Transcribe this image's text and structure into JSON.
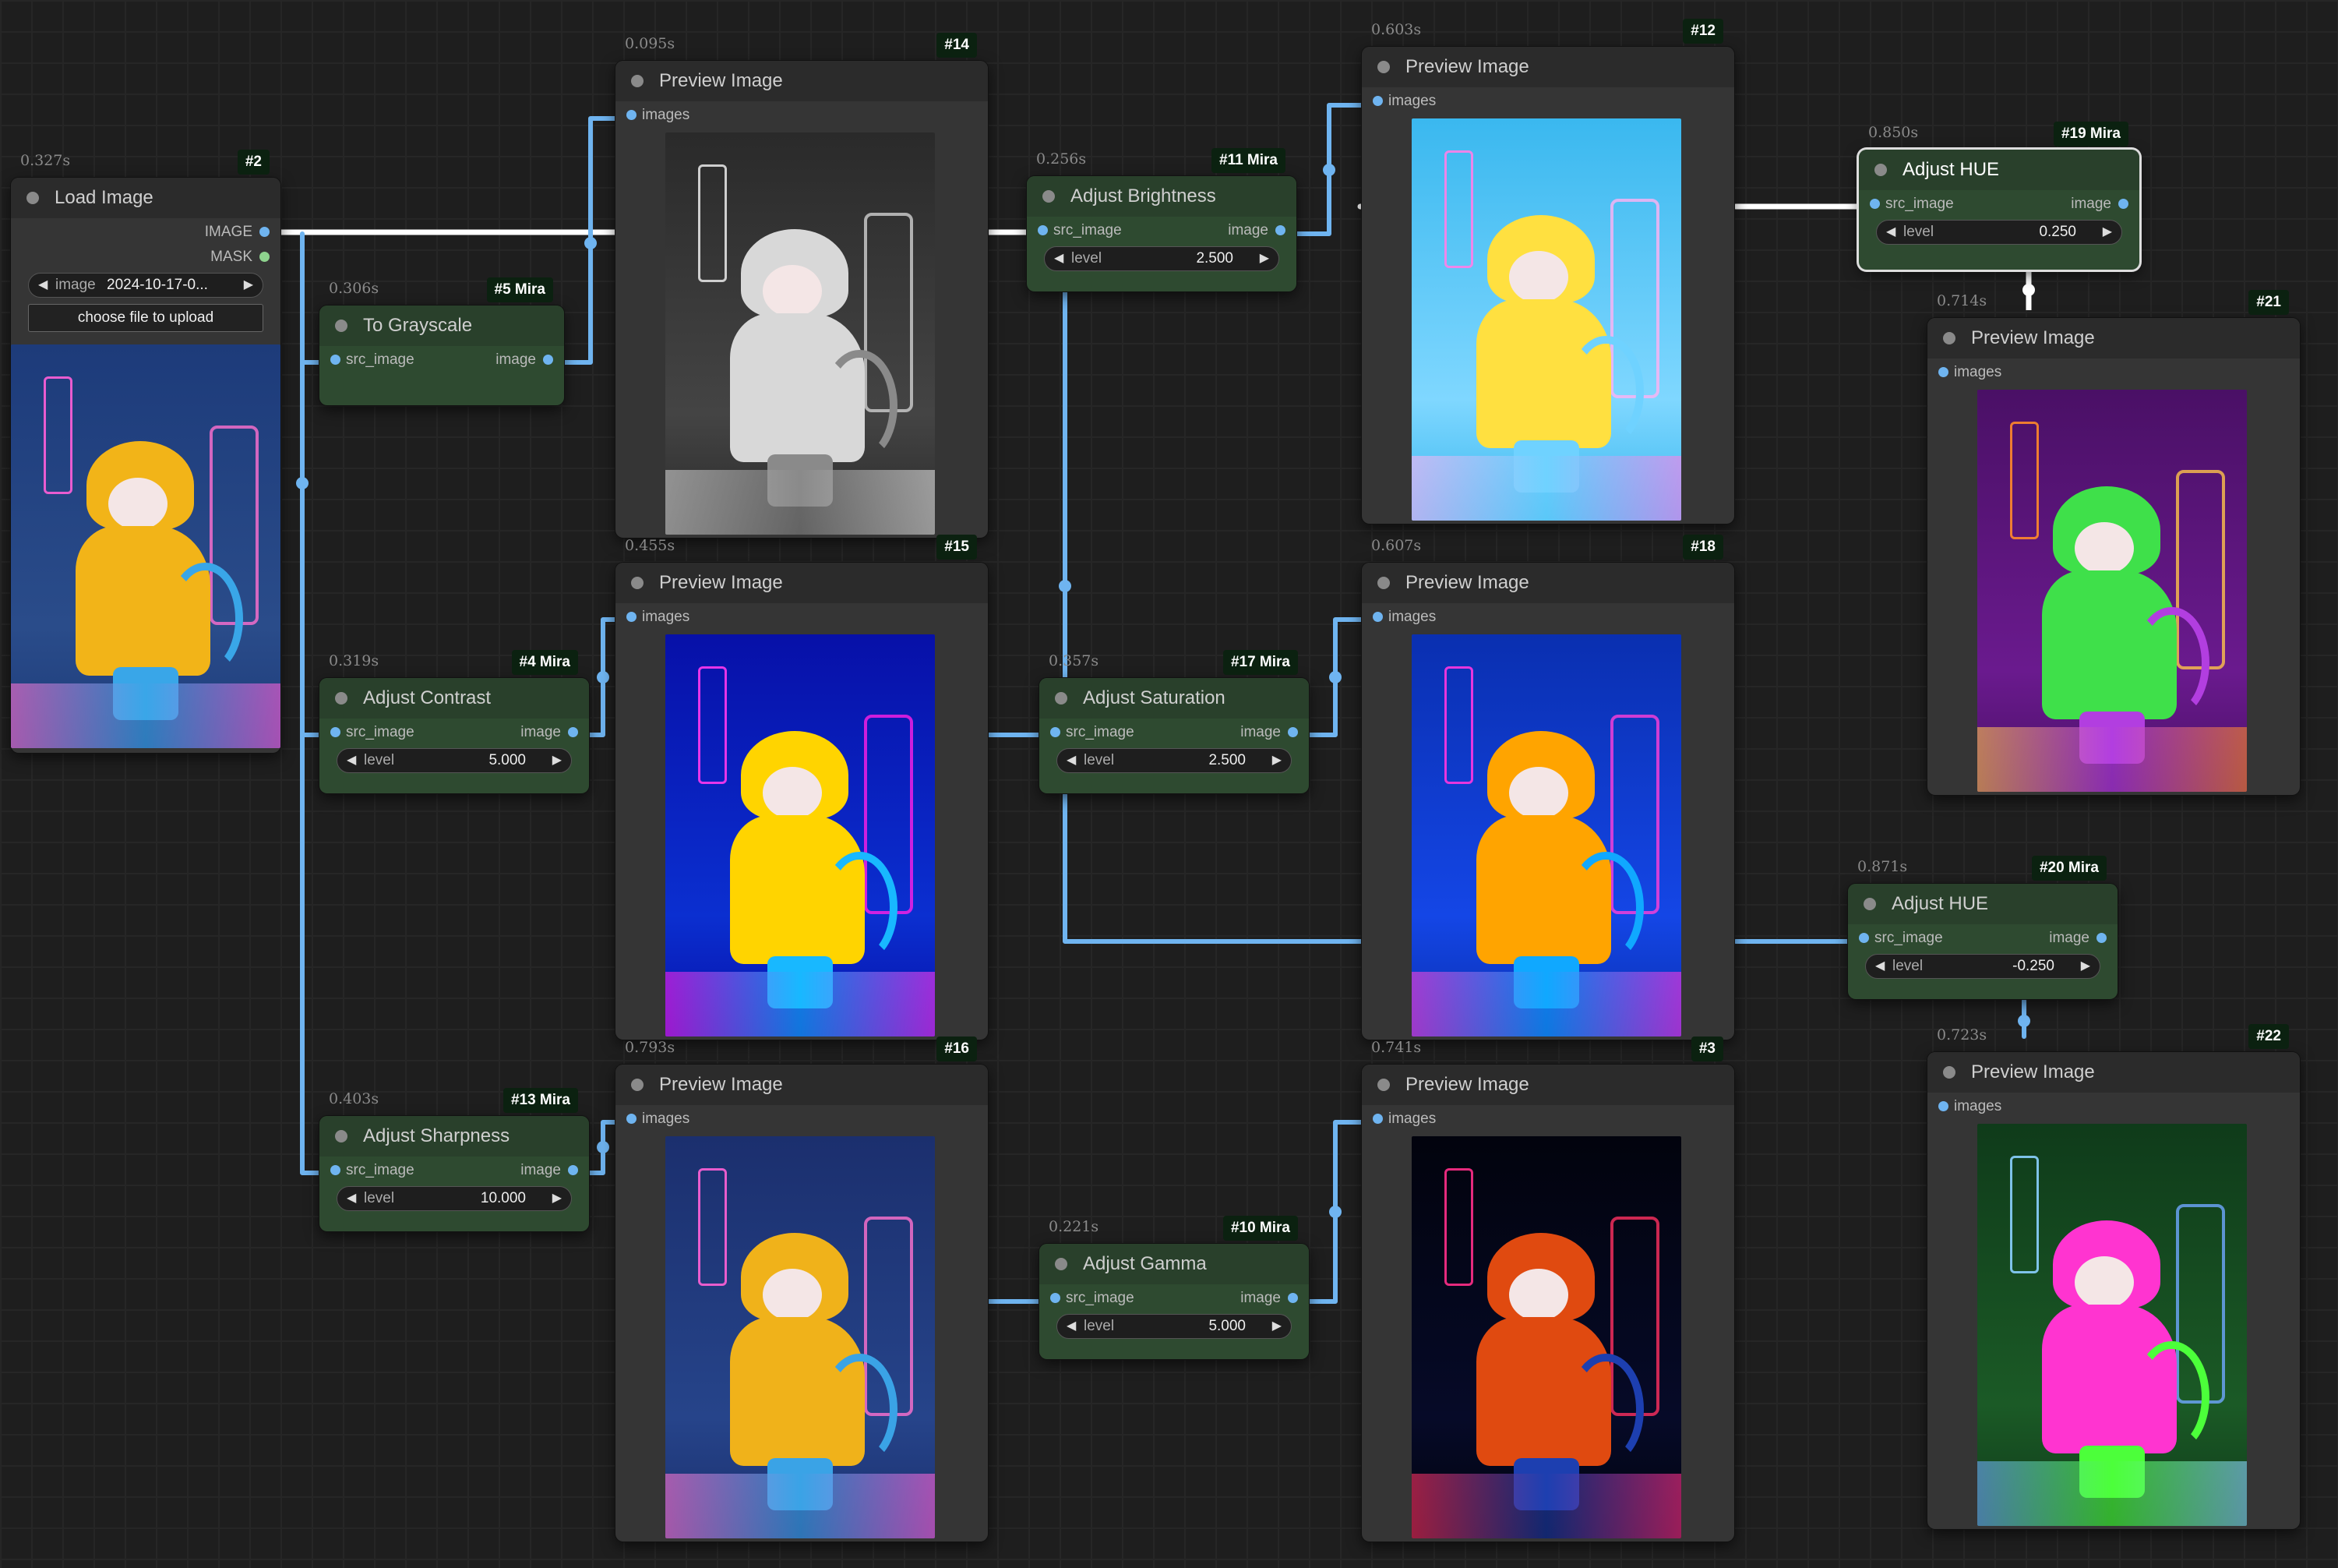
{
  "app": {
    "name": "ComfyUI node graph"
  },
  "nodes": {
    "load": {
      "time": "0.327s",
      "badge": "#2",
      "title": "Load Image",
      "outputs": [
        "IMAGE",
        "MASK"
      ],
      "widget": {
        "label": "image",
        "value": "2024-10-17-0..."
      },
      "upload_label": "choose file to upload"
    },
    "gray": {
      "time": "0.306s",
      "badge": "#5 Mira",
      "title": "To Grayscale",
      "input": "src_image",
      "output": "image"
    },
    "contrast": {
      "time": "0.319s",
      "badge": "#4 Mira",
      "title": "Adjust Contrast",
      "input": "src_image",
      "output": "image",
      "widget": {
        "label": "level",
        "value": "5.000"
      }
    },
    "sharp": {
      "time": "0.403s",
      "badge": "#13 Mira",
      "title": "Adjust Sharpness",
      "input": "src_image",
      "output": "image",
      "widget": {
        "label": "level",
        "value": "10.000"
      }
    },
    "p14": {
      "time": "0.095s",
      "badge": "#14",
      "title": "Preview Image",
      "input": "images"
    },
    "p15": {
      "time": "0.455s",
      "badge": "#15",
      "title": "Preview Image",
      "input": "images"
    },
    "p16": {
      "time": "0.793s",
      "badge": "#16",
      "title": "Preview Image",
      "input": "images"
    },
    "bright": {
      "time": "0.256s",
      "badge": "#11 Mira",
      "title": "Adjust Brightness",
      "input": "src_image",
      "output": "image",
      "widget": {
        "label": "level",
        "value": "2.500"
      }
    },
    "sat": {
      "time": "0.357s",
      "badge": "#17 Mira",
      "title": "Adjust Saturation",
      "input": "src_image",
      "output": "image",
      "widget": {
        "label": "level",
        "value": "2.500"
      }
    },
    "gamma": {
      "time": "0.221s",
      "badge": "#10 Mira",
      "title": "Adjust Gamma",
      "input": "src_image",
      "output": "image",
      "widget": {
        "label": "level",
        "value": "5.000"
      }
    },
    "p12": {
      "time": "0.603s",
      "badge": "#12",
      "title": "Preview Image",
      "input": "images"
    },
    "p18": {
      "time": "0.607s",
      "badge": "#18",
      "title": "Preview Image",
      "input": "images"
    },
    "p3": {
      "time": "0.741s",
      "badge": "#3",
      "title": "Preview Image",
      "input": "images"
    },
    "hue1": {
      "time": "0.850s",
      "badge": "#19 Mira",
      "title": "Adjust HUE",
      "input": "src_image",
      "output": "image",
      "widget": {
        "label": "level",
        "value": "0.250"
      }
    },
    "p21": {
      "time": "0.714s",
      "badge": "#21",
      "title": "Preview Image",
      "input": "images"
    },
    "hue2": {
      "time": "0.871s",
      "badge": "#20 Mira",
      "title": "Adjust HUE",
      "input": "src_image",
      "output": "image",
      "widget": {
        "label": "level",
        "value": "-0.250"
      }
    },
    "p22": {
      "time": "0.723s",
      "badge": "#22",
      "title": "Preview Image",
      "input": "images"
    }
  },
  "image_variants": {
    "original": {
      "sky": "#1d3b7a",
      "street": "#2a4c8a",
      "coat": "#f2b418",
      "hair": "#39a6e8",
      "neon": "#ff6fd0",
      "sign": "#ff5fd8"
    },
    "grayscale": {
      "sky": "#2a2a2a",
      "street": "#444444",
      "coat": "#d8d8d8",
      "hair": "#8a8a8a",
      "neon": "#cfcfcf",
      "sign": "#e0e0e0"
    },
    "contrast": {
      "sky": "#0710a8",
      "street": "#0b2fd0",
      "coat": "#ffd400",
      "hair": "#18b8ff",
      "neon": "#ff1fe6",
      "sign": "#ff38ee"
    },
    "sharpness": {
      "sky": "#1b2f6e",
      "street": "#26448a",
      "coat": "#f0b21a",
      "hair": "#3aa3e6",
      "neon": "#ff72cf",
      "sign": "#ff62d6"
    },
    "brightness": {
      "sky": "#3ab8ef",
      "street": "#7fd7ff",
      "coat": "#ffe040",
      "hair": "#6fd2ff",
      "neon": "#ffb1f2",
      "sign": "#ff7ee8"
    },
    "saturation": {
      "sky": "#0a2fb0",
      "street": "#1446e6",
      "coat": "#ffa400",
      "hair": "#10a8ff",
      "neon": "#ff3fd8",
      "sign": "#ff36e0"
    },
    "gamma": {
      "sky": "#02030d",
      "street": "#060a28",
      "coat": "#e04a10",
      "hair": "#1d3fb0",
      "neon": "#ff3060",
      "sign": "#ff2f8a"
    },
    "hue_plus": {
      "sky": "#4a1066",
      "street": "#6a1a8e",
      "coat": "#3fe04a",
      "hair": "#b23ee0",
      "neon": "#ffc34a",
      "sign": "#ff8a2a"
    },
    "hue_minus": {
      "sky": "#0f3b1a",
      "street": "#1b5a26",
      "coat": "#ff34d0",
      "hair": "#4cff3a",
      "neon": "#6fa8ff",
      "sign": "#8bd0ff"
    }
  }
}
